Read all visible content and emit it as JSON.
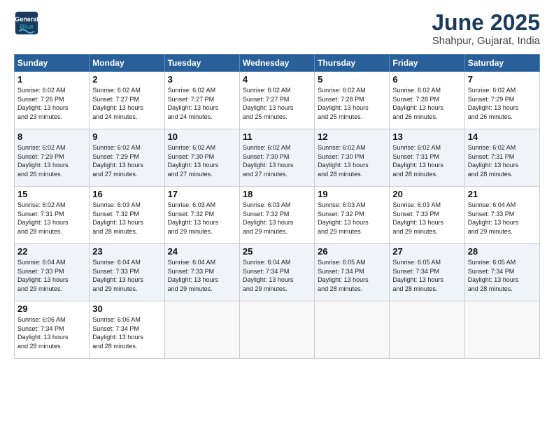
{
  "header": {
    "logo_line1": "General",
    "logo_line2": "Blue",
    "month_title": "June 2025",
    "location": "Shahpur, Gujarat, India"
  },
  "days_of_week": [
    "Sunday",
    "Monday",
    "Tuesday",
    "Wednesday",
    "Thursday",
    "Friday",
    "Saturday"
  ],
  "weeks": [
    [
      {
        "day": "1",
        "lines": [
          "Sunrise: 6:02 AM",
          "Sunset: 7:26 PM",
          "Daylight: 13 hours",
          "and 23 minutes."
        ]
      },
      {
        "day": "2",
        "lines": [
          "Sunrise: 6:02 AM",
          "Sunset: 7:27 PM",
          "Daylight: 13 hours",
          "and 24 minutes."
        ]
      },
      {
        "day": "3",
        "lines": [
          "Sunrise: 6:02 AM",
          "Sunset: 7:27 PM",
          "Daylight: 13 hours",
          "and 24 minutes."
        ]
      },
      {
        "day": "4",
        "lines": [
          "Sunrise: 6:02 AM",
          "Sunset: 7:27 PM",
          "Daylight: 13 hours",
          "and 25 minutes."
        ]
      },
      {
        "day": "5",
        "lines": [
          "Sunrise: 6:02 AM",
          "Sunset: 7:28 PM",
          "Daylight: 13 hours",
          "and 25 minutes."
        ]
      },
      {
        "day": "6",
        "lines": [
          "Sunrise: 6:02 AM",
          "Sunset: 7:28 PM",
          "Daylight: 13 hours",
          "and 26 minutes."
        ]
      },
      {
        "day": "7",
        "lines": [
          "Sunrise: 6:02 AM",
          "Sunset: 7:29 PM",
          "Daylight: 13 hours",
          "and 26 minutes."
        ]
      }
    ],
    [
      {
        "day": "8",
        "lines": [
          "Sunrise: 6:02 AM",
          "Sunset: 7:29 PM",
          "Daylight: 13 hours",
          "and 26 minutes."
        ]
      },
      {
        "day": "9",
        "lines": [
          "Sunrise: 6:02 AM",
          "Sunset: 7:29 PM",
          "Daylight: 13 hours",
          "and 27 minutes."
        ]
      },
      {
        "day": "10",
        "lines": [
          "Sunrise: 6:02 AM",
          "Sunset: 7:30 PM",
          "Daylight: 13 hours",
          "and 27 minutes."
        ]
      },
      {
        "day": "11",
        "lines": [
          "Sunrise: 6:02 AM",
          "Sunset: 7:30 PM",
          "Daylight: 13 hours",
          "and 27 minutes."
        ]
      },
      {
        "day": "12",
        "lines": [
          "Sunrise: 6:02 AM",
          "Sunset: 7:30 PM",
          "Daylight: 13 hours",
          "and 28 minutes."
        ]
      },
      {
        "day": "13",
        "lines": [
          "Sunrise: 6:02 AM",
          "Sunset: 7:31 PM",
          "Daylight: 13 hours",
          "and 28 minutes."
        ]
      },
      {
        "day": "14",
        "lines": [
          "Sunrise: 6:02 AM",
          "Sunset: 7:31 PM",
          "Daylight: 13 hours",
          "and 28 minutes."
        ]
      }
    ],
    [
      {
        "day": "15",
        "lines": [
          "Sunrise: 6:02 AM",
          "Sunset: 7:31 PM",
          "Daylight: 13 hours",
          "and 28 minutes."
        ]
      },
      {
        "day": "16",
        "lines": [
          "Sunrise: 6:03 AM",
          "Sunset: 7:32 PM",
          "Daylight: 13 hours",
          "and 28 minutes."
        ]
      },
      {
        "day": "17",
        "lines": [
          "Sunrise: 6:03 AM",
          "Sunset: 7:32 PM",
          "Daylight: 13 hours",
          "and 29 minutes."
        ]
      },
      {
        "day": "18",
        "lines": [
          "Sunrise: 6:03 AM",
          "Sunset: 7:32 PM",
          "Daylight: 13 hours",
          "and 29 minutes."
        ]
      },
      {
        "day": "19",
        "lines": [
          "Sunrise: 6:03 AM",
          "Sunset: 7:32 PM",
          "Daylight: 13 hours",
          "and 29 minutes."
        ]
      },
      {
        "day": "20",
        "lines": [
          "Sunrise: 6:03 AM",
          "Sunset: 7:33 PM",
          "Daylight: 13 hours",
          "and 29 minutes."
        ]
      },
      {
        "day": "21",
        "lines": [
          "Sunrise: 6:04 AM",
          "Sunset: 7:33 PM",
          "Daylight: 13 hours",
          "and 29 minutes."
        ]
      }
    ],
    [
      {
        "day": "22",
        "lines": [
          "Sunrise: 6:04 AM",
          "Sunset: 7:33 PM",
          "Daylight: 13 hours",
          "and 29 minutes."
        ]
      },
      {
        "day": "23",
        "lines": [
          "Sunrise: 6:04 AM",
          "Sunset: 7:33 PM",
          "Daylight: 13 hours",
          "and 29 minutes."
        ]
      },
      {
        "day": "24",
        "lines": [
          "Sunrise: 6:04 AM",
          "Sunset: 7:33 PM",
          "Daylight: 13 hours",
          "and 29 minutes."
        ]
      },
      {
        "day": "25",
        "lines": [
          "Sunrise: 6:04 AM",
          "Sunset: 7:34 PM",
          "Daylight: 13 hours",
          "and 29 minutes."
        ]
      },
      {
        "day": "26",
        "lines": [
          "Sunrise: 6:05 AM",
          "Sunset: 7:34 PM",
          "Daylight: 13 hours",
          "and 28 minutes."
        ]
      },
      {
        "day": "27",
        "lines": [
          "Sunrise: 6:05 AM",
          "Sunset: 7:34 PM",
          "Daylight: 13 hours",
          "and 28 minutes."
        ]
      },
      {
        "day": "28",
        "lines": [
          "Sunrise: 6:05 AM",
          "Sunset: 7:34 PM",
          "Daylight: 13 hours",
          "and 28 minutes."
        ]
      }
    ],
    [
      {
        "day": "29",
        "lines": [
          "Sunrise: 6:06 AM",
          "Sunset: 7:34 PM",
          "Daylight: 13 hours",
          "and 28 minutes."
        ]
      },
      {
        "day": "30",
        "lines": [
          "Sunrise: 6:06 AM",
          "Sunset: 7:34 PM",
          "Daylight: 13 hours",
          "and 28 minutes."
        ]
      },
      {
        "day": "",
        "lines": []
      },
      {
        "day": "",
        "lines": []
      },
      {
        "day": "",
        "lines": []
      },
      {
        "day": "",
        "lines": []
      },
      {
        "day": "",
        "lines": []
      }
    ]
  ]
}
